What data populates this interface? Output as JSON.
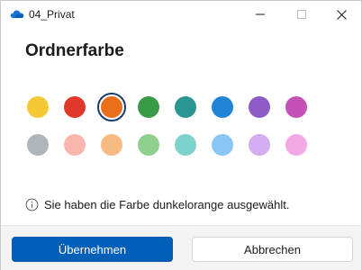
{
  "window": {
    "title": "04_Privat",
    "icon": "onedrive-cloud-icon"
  },
  "title_controls": {
    "minimize_icon": "minimize-icon",
    "maximize_icon": "maximize-icon",
    "close_icon": "close-icon"
  },
  "dialog": {
    "heading": "Ordnerfarbe",
    "selected_color_name": "dunkelorange",
    "info_text": "Sie haben die Farbe dunkelorange ausgewählt.",
    "info_icon": "info-icon"
  },
  "colors": {
    "row1": [
      "#f5c935",
      "#e0392b",
      "#e8701a",
      "#3a9b46",
      "#2a9591",
      "#2184d6",
      "#8f5cc7",
      "#c452b6"
    ],
    "row2": [
      "#b0b5ba",
      "#f9b6ad",
      "#f7ba82",
      "#8fd08e",
      "#7dd2ce",
      "#87c6f5",
      "#d4adf1",
      "#f3a9e4"
    ],
    "selected_row": 1,
    "selected_index": 2
  },
  "footer": {
    "primary_label": "Übernehmen",
    "secondary_label": "Abbrechen"
  }
}
